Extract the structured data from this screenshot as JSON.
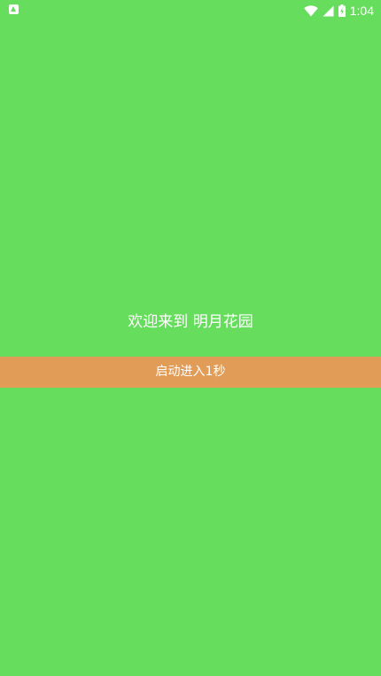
{
  "status_bar": {
    "time": "1:04",
    "icons": {
      "notification": "notification-a-icon",
      "wifi": "wifi-icon",
      "signal": "cell-signal-icon",
      "battery": "battery-charging-icon"
    }
  },
  "splash": {
    "welcome_text": "欢迎来到 明月花园",
    "enter_button_label": "启动进入1秒"
  },
  "colors": {
    "background": "#66dd5c",
    "button": "#e19c57",
    "text": "#ffffff"
  }
}
